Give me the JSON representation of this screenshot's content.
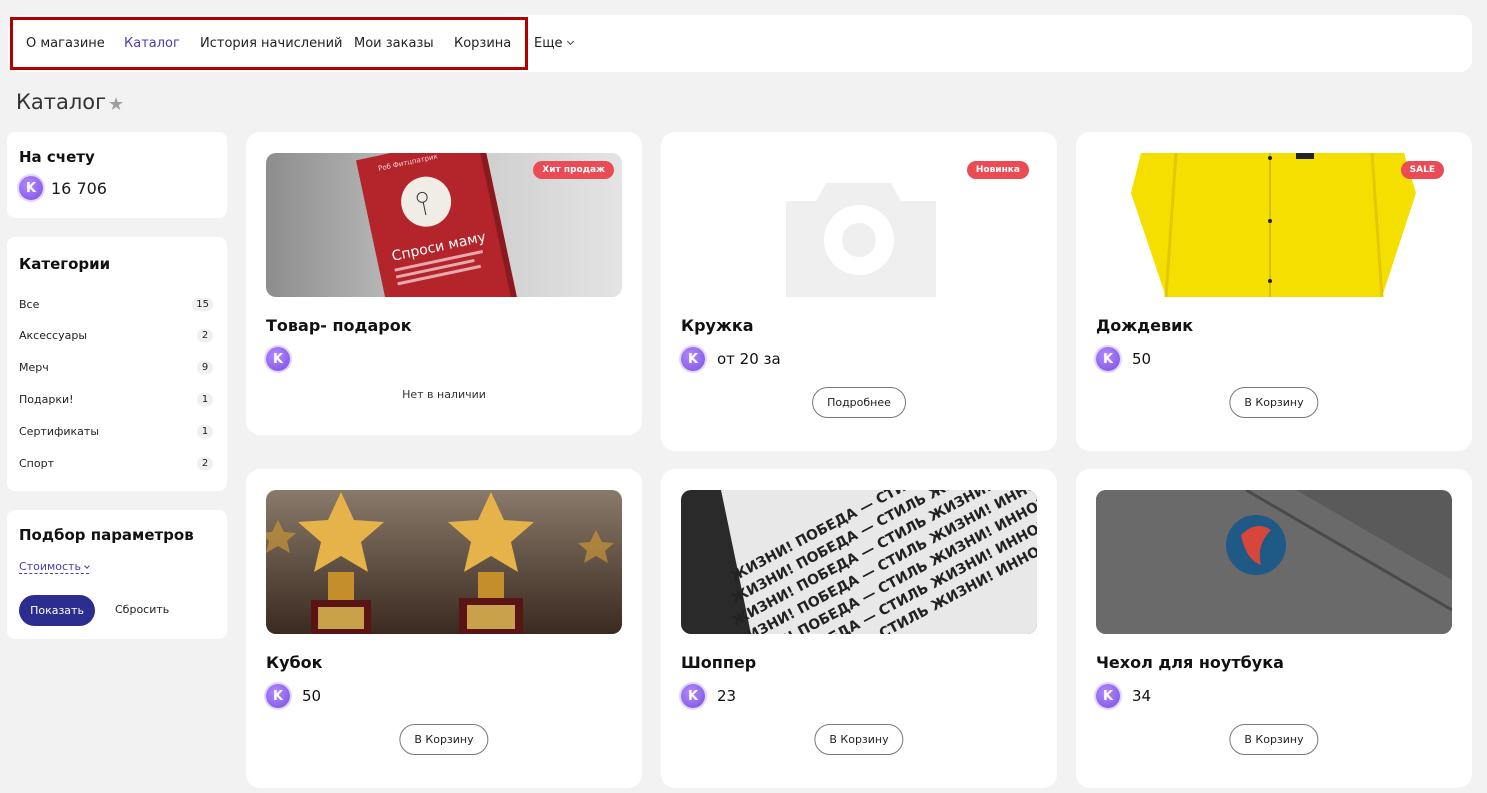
{
  "nav": {
    "items": [
      {
        "label": "О магазине"
      },
      {
        "label": "Каталог"
      },
      {
        "label": "История начислений"
      },
      {
        "label": "Мои заказы"
      },
      {
        "label": "Корзина"
      }
    ],
    "more_label": "Еще"
  },
  "page": {
    "title": "Каталог"
  },
  "account": {
    "title": "На счету",
    "balance": "16 706"
  },
  "categories": {
    "title": "Категории",
    "items": [
      {
        "label": "Все",
        "count": "15"
      },
      {
        "label": "Аксессуары",
        "count": "2"
      },
      {
        "label": "Мерч",
        "count": "9"
      },
      {
        "label": "Подарки!",
        "count": "1"
      },
      {
        "label": "Сертификаты",
        "count": "1"
      },
      {
        "label": "Спорт",
        "count": "2"
      }
    ]
  },
  "filters": {
    "title": "Подбор параметров",
    "cost_label": "Стоимость",
    "show_label": "Показать",
    "reset_label": "Сбросить"
  },
  "products": [
    {
      "title": "Товар- подарок",
      "badge": "Хит продаж",
      "price": "",
      "status": "Нет в наличии",
      "action": ""
    },
    {
      "title": "Кружка",
      "badge": "Новинка",
      "price": "от 20 за",
      "status": "",
      "action": "Подробнее"
    },
    {
      "title": "Дождевик",
      "badge": "SALE",
      "price": "50",
      "status": "",
      "action": "В Корзину"
    },
    {
      "title": "Кубок",
      "badge": "",
      "price": "50",
      "status": "",
      "action": "В Корзину"
    },
    {
      "title": "Шоппер",
      "badge": "",
      "price": "23",
      "status": "",
      "action": "В Корзину"
    },
    {
      "title": "Чехол для ноутбука",
      "badge": "",
      "price": "34",
      "status": "",
      "action": "В Корзину"
    }
  ],
  "colors": {
    "accent": "#4a3fa8",
    "primary_button": "#2b2d8f",
    "badge": "#ea4b55",
    "highlight_frame": "#b00000"
  },
  "images": {
    "book": {
      "title": "Спроси маму",
      "author": "Роб Фитцпатрик"
    },
    "shopper_text": "ЖИЗНИ! ПОБЕДА — СТИЛЬ ЖИЗНИ! ИННОВАЦИИ! ОБРАЗ МЫ"
  }
}
